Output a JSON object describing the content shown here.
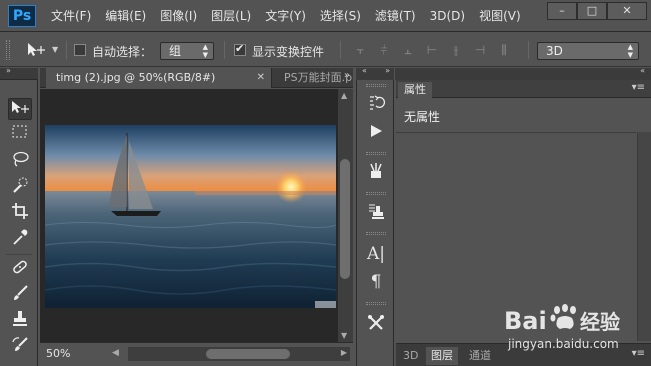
{
  "app": {
    "logo": "Ps"
  },
  "menu": [
    "文件(F)",
    "编辑(E)",
    "图像(I)",
    "图层(L)",
    "文字(Y)",
    "选择(S)",
    "滤镜(T)",
    "3D(D)",
    "视图(V)"
  ],
  "window_controls": {
    "minimize": "–",
    "maximize": "□",
    "close": "✕"
  },
  "options_bar": {
    "tool_icon": "move-tool-icon",
    "auto_select_label": "自动选择：",
    "auto_select_checked": false,
    "auto_select_target": "组",
    "show_transform_label": "显示变换控件",
    "show_transform_checked": true,
    "mode_3d": "3D"
  },
  "document": {
    "active_tab": "timg (2).jpg @ 50%(RGB/8#)",
    "inactive_tab": "PS万能封面.p",
    "zoom": "50%"
  },
  "toolbox": [
    "move-tool",
    "marquee-tool",
    "lasso-tool",
    "quick-select-tool",
    "crop-tool",
    "eyedropper-tool",
    "healing-brush-tool",
    "brush-tool",
    "clone-stamp-tool",
    "history-brush-tool"
  ],
  "dock": [
    "history-icon",
    "actions-play-icon",
    "tool-presets-icon",
    "clone-source-icon",
    "character-icon",
    "paragraph-icon",
    "tools-icon"
  ],
  "properties": {
    "tab": "属性",
    "content": "无属性"
  },
  "bottom_tabs": [
    "3D",
    "图层",
    "通道"
  ],
  "bottom_active": "图层",
  "watermark": {
    "brand": "Bai",
    "brand_cn": "经验",
    "url": "jingyan.baidu.com"
  },
  "colors": {
    "accent": "#31a8ff",
    "panel": "#535353",
    "dark": "#282828"
  }
}
